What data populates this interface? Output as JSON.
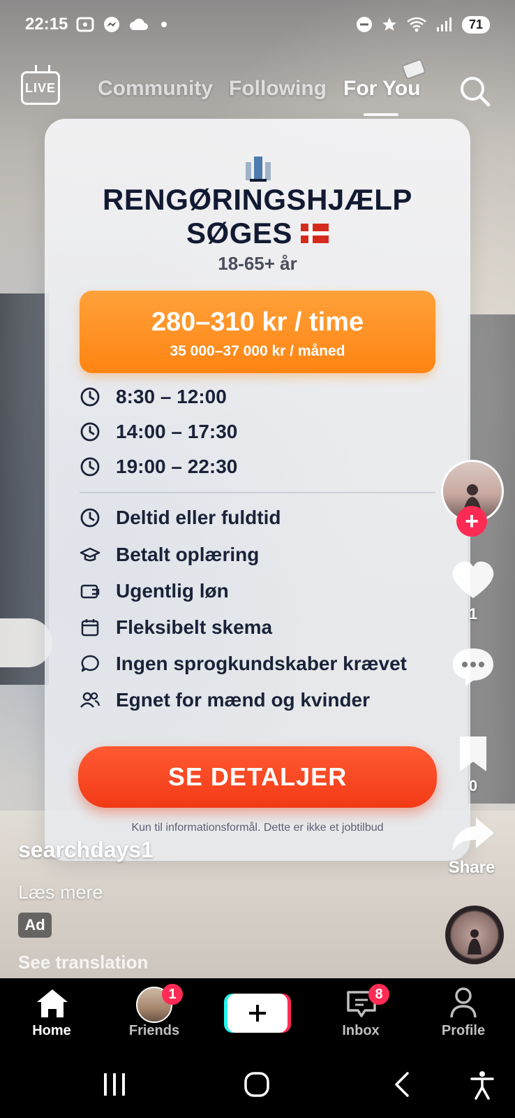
{
  "status_bar": {
    "time": "22:15",
    "battery": "71"
  },
  "top_nav": {
    "live_label": "LIVE",
    "tabs": [
      {
        "label": "Community"
      },
      {
        "label": "Following"
      },
      {
        "label": "For You"
      }
    ]
  },
  "ad_card": {
    "title_line1": "RENGØRINGSHJÆLP",
    "title_line2": "SØGES",
    "age": "18-65+ år",
    "pay_main": "280–310 kr / time",
    "pay_sub": "35 000–37 000 kr / måned",
    "schedules": [
      "8:30 – 12:00",
      "14:00 – 17:30",
      "19:00 – 22:30"
    ],
    "features": [
      {
        "icon": "clock-icon",
        "label": "Deltid eller fuldtid"
      },
      {
        "icon": "graduation-cap-icon",
        "label": "Betalt oplæring"
      },
      {
        "icon": "wallet-icon",
        "label": "Ugentlig løn"
      },
      {
        "icon": "calendar-icon",
        "label": "Fleksibelt skema"
      },
      {
        "icon": "chat-bubble-icon",
        "label": "Ingen sprogkundskaber krævet"
      },
      {
        "icon": "users-icon",
        "label": "Egnet for mænd og kvinder"
      }
    ],
    "cta_label": "SE DETALJER",
    "disclaimer": "Kun til informationsformål. Dette er ikke et jobtilbud"
  },
  "action_rail": {
    "like_count": "1",
    "bookmark_count": "0",
    "share_label": "Share"
  },
  "caption": {
    "author": "searchdays1",
    "read_more": "Læs mere",
    "ad_badge": "Ad",
    "see_translation": "See translation"
  },
  "bottom_nav": {
    "items": [
      {
        "label": "Home"
      },
      {
        "label": "Friends",
        "badge": "1"
      },
      {
        "label": "Inbox",
        "badge": "8"
      },
      {
        "label": "Profile"
      }
    ]
  },
  "colors": {
    "accent_pink": "#fe2c55",
    "accent_cyan": "#25f4ee",
    "pay_orange": "#ff8412",
    "cta_red": "#f23a16",
    "card_text": "#16213a"
  }
}
